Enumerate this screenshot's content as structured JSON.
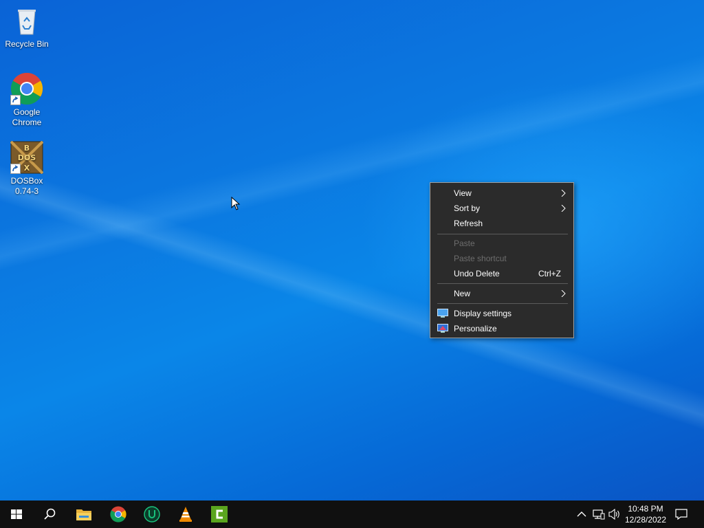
{
  "desktop": {
    "icons": [
      {
        "label": "Recycle Bin"
      },
      {
        "label": "Google\nChrome"
      },
      {
        "label": "DOSBox\n0.74-3"
      }
    ]
  },
  "context_menu": {
    "items": [
      {
        "label": "View",
        "submenu": true
      },
      {
        "label": "Sort by",
        "submenu": true
      },
      {
        "label": "Refresh"
      },
      {
        "label": "Paste",
        "disabled": true
      },
      {
        "label": "Paste shortcut",
        "disabled": true
      },
      {
        "label": "Undo Delete",
        "shortcut": "Ctrl+Z"
      },
      {
        "label": "New",
        "submenu": true
      },
      {
        "label": "Display settings",
        "icon": "display-settings-icon"
      },
      {
        "label": "Personalize",
        "icon": "personalize-icon"
      }
    ]
  },
  "taskbar": {
    "pinned": [
      "start-icon",
      "search-icon",
      "file-explorer-icon",
      "chrome-icon",
      "ultraviewer-icon",
      "vlc-icon",
      "camtasia-icon"
    ],
    "tray": [
      "chevron-up-icon",
      "network-icon",
      "volume-icon"
    ],
    "clock": {
      "time": "10:48 PM",
      "date": "12/28/2022"
    },
    "notifications": "action-center-icon"
  },
  "colors": {
    "menu_bg": "#2b2b2b",
    "taskbar_bg": "#101010",
    "desktop_blue": "#0a78e0"
  }
}
